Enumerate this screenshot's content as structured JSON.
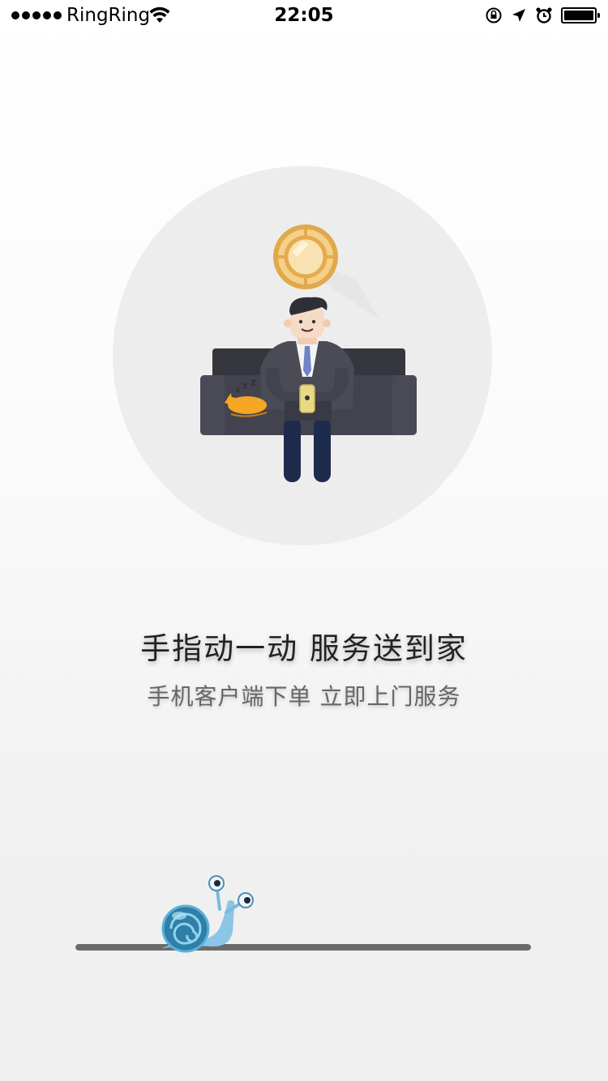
{
  "status_bar": {
    "carrier": "RingRing",
    "time": "22:05",
    "icons": [
      "signal-dots-icon",
      "wifi-icon",
      "rotation-lock-icon",
      "location-arrow-icon",
      "alarm-icon",
      "battery-icon"
    ]
  },
  "splash": {
    "headline": "手指动一动  服务送到家",
    "subline": "手机客户端下单 立即上门服务",
    "illustration": [
      "gold-coin-icon",
      "businessman-on-sofa",
      "sleeping-cat",
      "phone-icon",
      "sleep-zzz-icon"
    ]
  },
  "loading": {
    "progress_fraction": 1.0,
    "snail_position_fraction": 0.29,
    "colors": {
      "track": "#d9d9d9",
      "fill": "#6b6b6b"
    }
  },
  "colors": {
    "circle": "#ededed",
    "sofa": "#3f3f4a",
    "coin": "#f1c774",
    "cat": "#f5a623",
    "pants": "#1f2b4d"
  }
}
